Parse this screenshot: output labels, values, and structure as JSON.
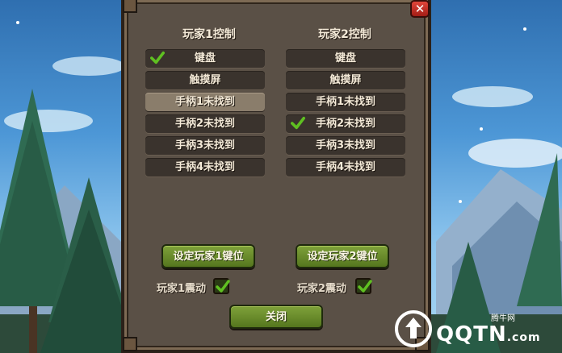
{
  "player1": {
    "title": "玩家1控制",
    "options": [
      "键盘",
      "触摸屏",
      "手柄1未找到",
      "手柄2未找到",
      "手柄3未找到",
      "手柄4未找到"
    ],
    "checked_option": "键盘",
    "highlighted_option": "手柄1未找到",
    "keybind_button": "设定玩家1键位",
    "vibration_label": "玩家1震动",
    "vibration_on": true
  },
  "player2": {
    "title": "玩家2控制",
    "options": [
      "键盘",
      "触摸屏",
      "手柄1未找到",
      "手柄2未找到",
      "手柄3未找到",
      "手柄4未找到"
    ],
    "checked_option": "手柄2未找到",
    "keybind_button": "设定玩家2键位",
    "vibration_label": "玩家2震动",
    "vibration_on": true
  },
  "close_button": "关闭",
  "close_icon": "✕",
  "watermark": {
    "text": "QQTN",
    "domain": ".com",
    "small": "腾牛网"
  },
  "colors": {
    "panel": "#5a5046",
    "button_green": "#6b8f2c",
    "check_green": "#4caf1c",
    "close_red": "#c9302c"
  }
}
